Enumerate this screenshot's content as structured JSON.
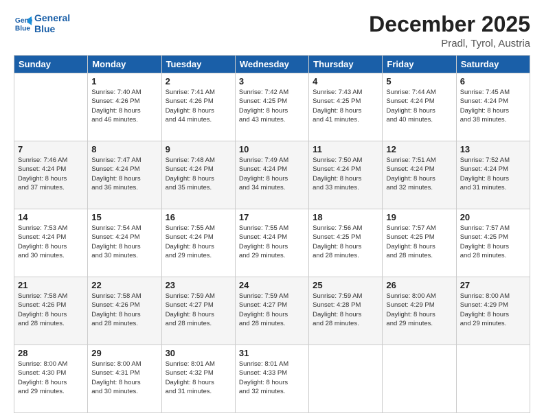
{
  "header": {
    "logo_line1": "General",
    "logo_line2": "Blue",
    "month_title": "December 2025",
    "location": "Pradl, Tyrol, Austria"
  },
  "weekdays": [
    "Sunday",
    "Monday",
    "Tuesday",
    "Wednesday",
    "Thursday",
    "Friday",
    "Saturday"
  ],
  "weeks": [
    [
      {
        "day": "",
        "info": ""
      },
      {
        "day": "1",
        "info": "Sunrise: 7:40 AM\nSunset: 4:26 PM\nDaylight: 8 hours\nand 46 minutes."
      },
      {
        "day": "2",
        "info": "Sunrise: 7:41 AM\nSunset: 4:26 PM\nDaylight: 8 hours\nand 44 minutes."
      },
      {
        "day": "3",
        "info": "Sunrise: 7:42 AM\nSunset: 4:25 PM\nDaylight: 8 hours\nand 43 minutes."
      },
      {
        "day": "4",
        "info": "Sunrise: 7:43 AM\nSunset: 4:25 PM\nDaylight: 8 hours\nand 41 minutes."
      },
      {
        "day": "5",
        "info": "Sunrise: 7:44 AM\nSunset: 4:24 PM\nDaylight: 8 hours\nand 40 minutes."
      },
      {
        "day": "6",
        "info": "Sunrise: 7:45 AM\nSunset: 4:24 PM\nDaylight: 8 hours\nand 38 minutes."
      }
    ],
    [
      {
        "day": "7",
        "info": "Sunrise: 7:46 AM\nSunset: 4:24 PM\nDaylight: 8 hours\nand 37 minutes."
      },
      {
        "day": "8",
        "info": "Sunrise: 7:47 AM\nSunset: 4:24 PM\nDaylight: 8 hours\nand 36 minutes."
      },
      {
        "day": "9",
        "info": "Sunrise: 7:48 AM\nSunset: 4:24 PM\nDaylight: 8 hours\nand 35 minutes."
      },
      {
        "day": "10",
        "info": "Sunrise: 7:49 AM\nSunset: 4:24 PM\nDaylight: 8 hours\nand 34 minutes."
      },
      {
        "day": "11",
        "info": "Sunrise: 7:50 AM\nSunset: 4:24 PM\nDaylight: 8 hours\nand 33 minutes."
      },
      {
        "day": "12",
        "info": "Sunrise: 7:51 AM\nSunset: 4:24 PM\nDaylight: 8 hours\nand 32 minutes."
      },
      {
        "day": "13",
        "info": "Sunrise: 7:52 AM\nSunset: 4:24 PM\nDaylight: 8 hours\nand 31 minutes."
      }
    ],
    [
      {
        "day": "14",
        "info": "Sunrise: 7:53 AM\nSunset: 4:24 PM\nDaylight: 8 hours\nand 30 minutes."
      },
      {
        "day": "15",
        "info": "Sunrise: 7:54 AM\nSunset: 4:24 PM\nDaylight: 8 hours\nand 30 minutes."
      },
      {
        "day": "16",
        "info": "Sunrise: 7:55 AM\nSunset: 4:24 PM\nDaylight: 8 hours\nand 29 minutes."
      },
      {
        "day": "17",
        "info": "Sunrise: 7:55 AM\nSunset: 4:24 PM\nDaylight: 8 hours\nand 29 minutes."
      },
      {
        "day": "18",
        "info": "Sunrise: 7:56 AM\nSunset: 4:25 PM\nDaylight: 8 hours\nand 28 minutes."
      },
      {
        "day": "19",
        "info": "Sunrise: 7:57 AM\nSunset: 4:25 PM\nDaylight: 8 hours\nand 28 minutes."
      },
      {
        "day": "20",
        "info": "Sunrise: 7:57 AM\nSunset: 4:25 PM\nDaylight: 8 hours\nand 28 minutes."
      }
    ],
    [
      {
        "day": "21",
        "info": "Sunrise: 7:58 AM\nSunset: 4:26 PM\nDaylight: 8 hours\nand 28 minutes."
      },
      {
        "day": "22",
        "info": "Sunrise: 7:58 AM\nSunset: 4:26 PM\nDaylight: 8 hours\nand 28 minutes."
      },
      {
        "day": "23",
        "info": "Sunrise: 7:59 AM\nSunset: 4:27 PM\nDaylight: 8 hours\nand 28 minutes."
      },
      {
        "day": "24",
        "info": "Sunrise: 7:59 AM\nSunset: 4:27 PM\nDaylight: 8 hours\nand 28 minutes."
      },
      {
        "day": "25",
        "info": "Sunrise: 7:59 AM\nSunset: 4:28 PM\nDaylight: 8 hours\nand 28 minutes."
      },
      {
        "day": "26",
        "info": "Sunrise: 8:00 AM\nSunset: 4:29 PM\nDaylight: 8 hours\nand 29 minutes."
      },
      {
        "day": "27",
        "info": "Sunrise: 8:00 AM\nSunset: 4:29 PM\nDaylight: 8 hours\nand 29 minutes."
      }
    ],
    [
      {
        "day": "28",
        "info": "Sunrise: 8:00 AM\nSunset: 4:30 PM\nDaylight: 8 hours\nand 29 minutes."
      },
      {
        "day": "29",
        "info": "Sunrise: 8:00 AM\nSunset: 4:31 PM\nDaylight: 8 hours\nand 30 minutes."
      },
      {
        "day": "30",
        "info": "Sunrise: 8:01 AM\nSunset: 4:32 PM\nDaylight: 8 hours\nand 31 minutes."
      },
      {
        "day": "31",
        "info": "Sunrise: 8:01 AM\nSunset: 4:33 PM\nDaylight: 8 hours\nand 32 minutes."
      },
      {
        "day": "",
        "info": ""
      },
      {
        "day": "",
        "info": ""
      },
      {
        "day": "",
        "info": ""
      }
    ]
  ]
}
